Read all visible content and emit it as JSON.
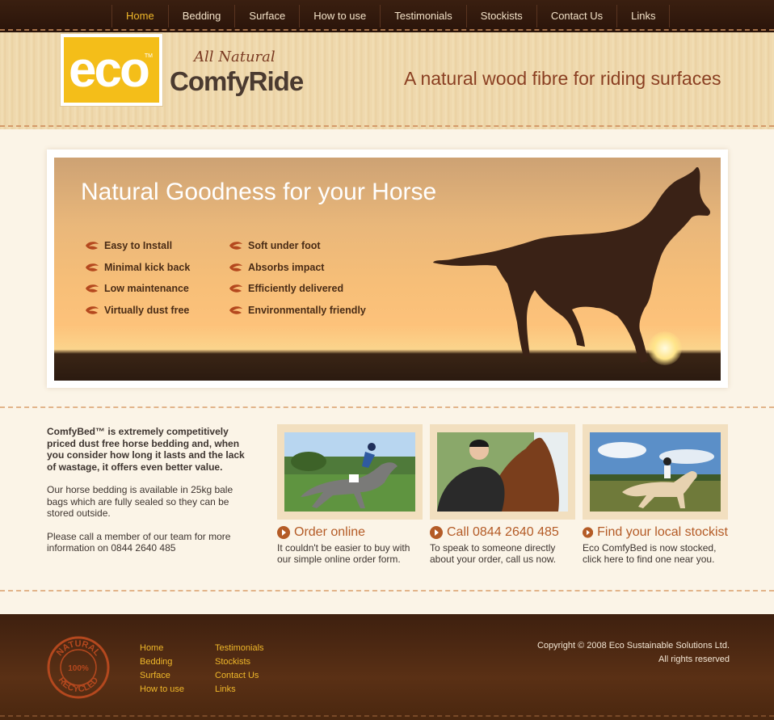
{
  "nav": {
    "items": [
      {
        "label": "Home",
        "active": true
      },
      {
        "label": "Bedding"
      },
      {
        "label": "Surface"
      },
      {
        "label": "How to use"
      },
      {
        "label": "Testimonials"
      },
      {
        "label": "Stockists"
      },
      {
        "label": "Contact Us"
      },
      {
        "label": "Links"
      }
    ]
  },
  "header": {
    "logo_text": "eco",
    "logo_tm": "TM",
    "brand_prefix": "All Natural",
    "brand_name": "ComfyRide",
    "tagline": "A natural wood fibre for riding surfaces"
  },
  "hero": {
    "title": "Natural Goodness for your Horse",
    "features_col1": [
      "Easy to Install",
      "Minimal kick back",
      "Low maintenance",
      "Virtually dust free"
    ],
    "features_col2": [
      "Soft under foot",
      "Absorbs impact",
      "Efficiently delivered",
      "Environmentally friendly"
    ]
  },
  "intro": {
    "p1": "ComfyBed™ is extremely competitively priced dust free horse bedding and, when you consider how long it lasts and the lack of wastage, it offers even better value.",
    "p2": "Our horse bedding is available in 25kg bale bags which are fully sealed so they can be stored outside.",
    "p3": "Please call a member of our team for more information on 0844 2640 485"
  },
  "cards": [
    {
      "title": "Order online",
      "desc": "It couldn't be easier to buy with our simple online order form."
    },
    {
      "title": "Call 0844 2640 485",
      "desc": "To speak to someone directly about your order, call us now."
    },
    {
      "title": "Find your local stockist",
      "desc": "Eco ComfyBed is now stocked, click here to find one near you."
    }
  ],
  "footer": {
    "stamp_top": "NATURAL",
    "stamp_mid": "100%",
    "stamp_bottom": "RECYCLED",
    "links_col1": [
      "Home",
      "Bedding",
      "Surface",
      "How to use"
    ],
    "links_col2": [
      "Testimonials",
      "Stockists",
      "Contact Us",
      "Links"
    ],
    "copyright": "Copyright © 2008 Eco Sustainable Solutions Ltd.",
    "rights": "All rights reserved"
  },
  "colors": {
    "accent_orange": "#b45b26",
    "logo_yellow": "#f4be19",
    "nav_active": "#f0b82a",
    "footer_brown": "#4a270f"
  }
}
